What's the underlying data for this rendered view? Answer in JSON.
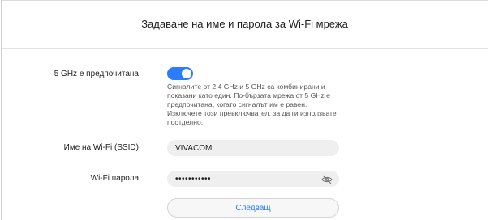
{
  "page": {
    "title": "Задаване на име и парола за Wi-Fi мрежа"
  },
  "pref5g": {
    "label": "5 GHz е предпочитана",
    "enabled": true,
    "description": "Сигналите от 2,4 GHz и 5 GHz са комбинирани и показани като един. По-бързата мрежа от 5 GHz е предпочитана, когато сигналът им е равен. Изключете този превключвател, за да ги използвате поотделно."
  },
  "ssid": {
    "label": "Име на Wi-Fi (SSID)",
    "value": "VIVACOM"
  },
  "password": {
    "label": "Wi-Fi парола",
    "masked": "•••••••••••"
  },
  "next_button": {
    "label": "Следващ"
  },
  "colors": {
    "accent": "#2b7cff",
    "field_bg": "#efefef"
  },
  "icons": {
    "password_visibility": "eye-off-icon"
  }
}
